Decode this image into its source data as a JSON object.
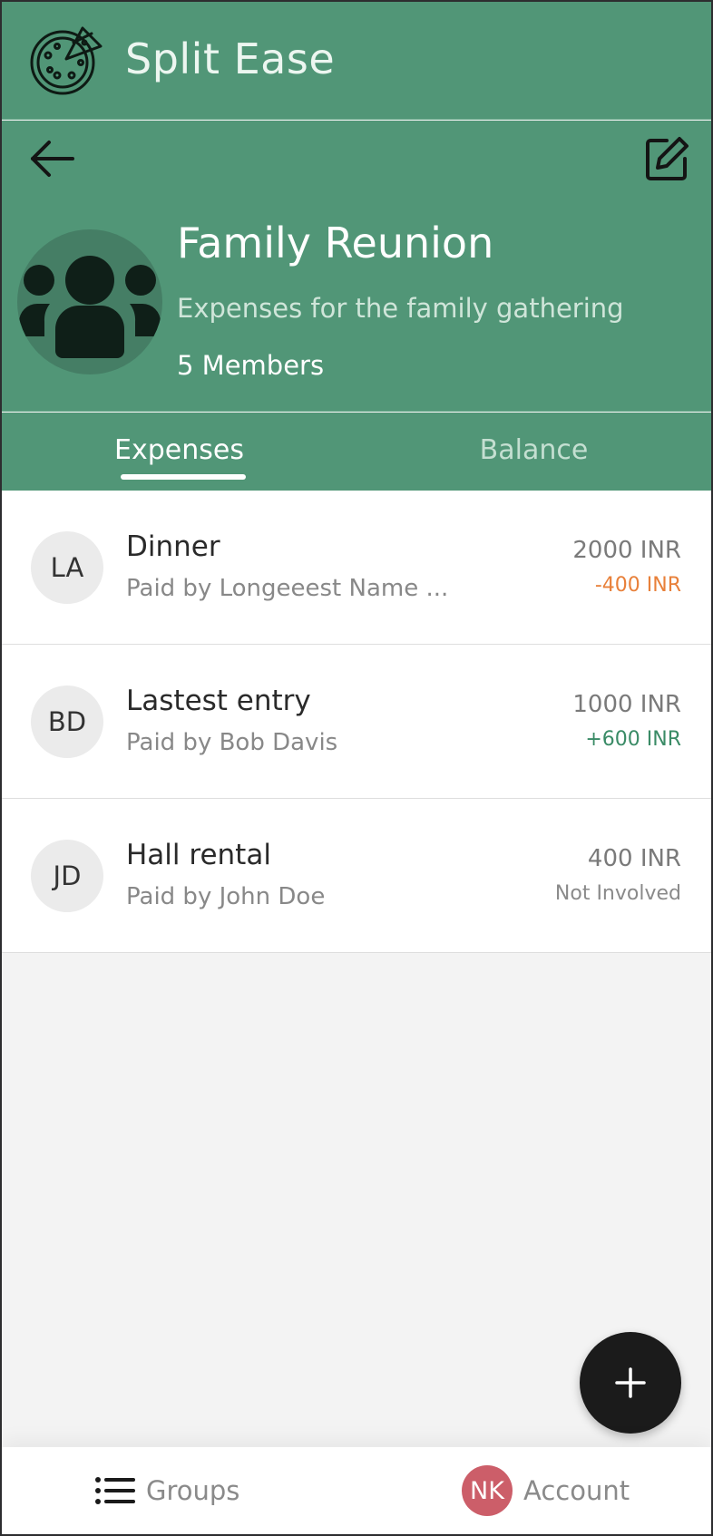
{
  "app": {
    "title": "Split Ease",
    "logo_icon": "pizza-icon"
  },
  "group": {
    "name": "Family Reunion",
    "description": "Expenses for the family gathering",
    "members_label": "5 Members",
    "avatar_icon": "group-people-icon"
  },
  "toolbar": {
    "back_icon": "arrow-left-icon",
    "edit_icon": "edit-icon"
  },
  "tabs": [
    {
      "label": "Expenses",
      "active": true
    },
    {
      "label": "Balance",
      "active": false
    }
  ],
  "expenses": [
    {
      "initials": "LA",
      "title": "Dinner",
      "paid_by": "Paid by Longeeest Name ...",
      "amount": "2000 INR",
      "share": "-400 INR",
      "share_color": "#e8803a"
    },
    {
      "initials": "BD",
      "title": "Lastest entry",
      "paid_by": "Paid by Bob Davis",
      "amount": "1000 INR",
      "share": "+600 INR",
      "share_color": "#3a8b66"
    },
    {
      "initials": "JD",
      "title": "Hall rental",
      "paid_by": "Paid by John Doe",
      "amount": "400 INR",
      "share": "Not Involved",
      "share_color": "#8a8a8a"
    }
  ],
  "fab": {
    "icon": "plus-icon"
  },
  "bottom_nav": {
    "groups_label": "Groups",
    "groups_icon": "list-icon",
    "account_label": "Account",
    "account_initials": "NK"
  },
  "colors": {
    "primary": "#519677",
    "negative": "#e8803a",
    "positive": "#3a8b66",
    "account_avatar": "#cc5e69"
  }
}
